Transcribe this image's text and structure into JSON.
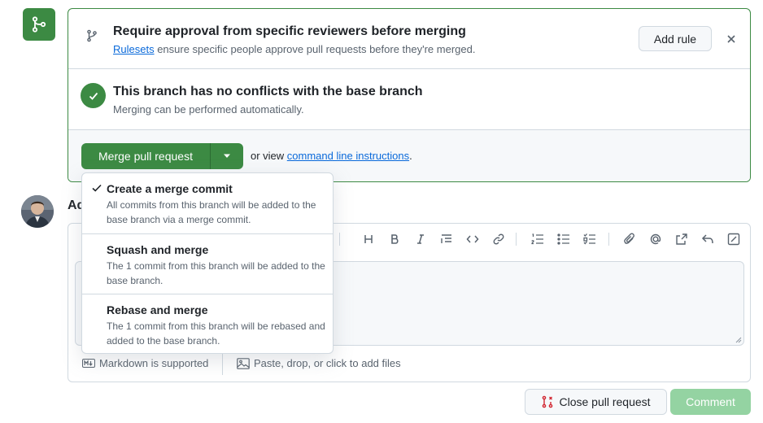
{
  "approval": {
    "title": "Require approval from specific reviewers before merging",
    "desc_link": "Rulesets",
    "desc_rest": " ensure specific people approve pull requests before they're merged.",
    "add_rule_label": "Add rule"
  },
  "conflicts": {
    "title": "This branch has no conflicts with the base branch",
    "desc": "Merging can be performed automatically."
  },
  "merge": {
    "button_label": "Merge pull request",
    "or_view": "or view ",
    "cli_link": "command line instructions",
    "period": "."
  },
  "dropdown": {
    "items": [
      {
        "title": "Create a merge commit",
        "desc": "All commits from this branch will be added to the base branch via a merge commit.",
        "selected": true
      },
      {
        "title": "Squash and merge",
        "desc": "The 1 commit from this branch will be added to the base branch.",
        "selected": false
      },
      {
        "title": "Rebase and merge",
        "desc": "The 1 commit from this branch will be rebased and added to the base branch.",
        "selected": false
      }
    ]
  },
  "comment": {
    "heading_partial": "Ad",
    "markdown_note": "Markdown is supported",
    "attach_note": "Paste, drop, or click to add files",
    "close_pr_label": "Close pull request",
    "comment_label": "Comment"
  },
  "colors": {
    "merge_green": "#3c8a43",
    "link_blue": "#0969da",
    "disabled_green": "#94d3a2",
    "close_red": "#d1242f"
  }
}
